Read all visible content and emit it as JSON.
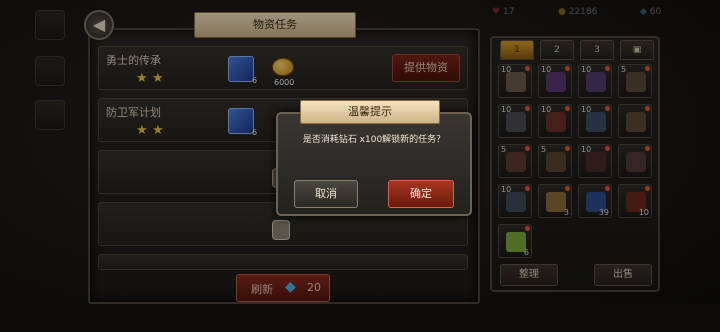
{
  "panel": {
    "title": "物资任务"
  },
  "quests": [
    {
      "name": "勇士的传承",
      "stars": 2,
      "book_qty": "6",
      "gold_qty": "6000"
    },
    {
      "name": "防卫军计划",
      "stars": 2,
      "book_qty": "6"
    }
  ],
  "supply_button": "提供物资",
  "refresh": {
    "label": "刷新",
    "cost": "20"
  },
  "resources": {
    "hp": "17",
    "gold": "22186",
    "diamond": "60"
  },
  "inventory": {
    "tabs": [
      "1",
      "2",
      "3"
    ],
    "slots": [
      {
        "qty": "10",
        "color": "#6b5a4c"
      },
      {
        "qty": "10",
        "color": "#5a3a72"
      },
      {
        "qty": "10",
        "color": "#4f3b6e"
      },
      {
        "qty": "5",
        "color": "#5a4a3a"
      },
      {
        "qty": "10",
        "color": "#4b4b55"
      },
      {
        "qty": "10",
        "color": "#6a3025"
      },
      {
        "qty": "10",
        "color": "#3b4d66"
      },
      {
        "qty": "",
        "color": "#5c4a35"
      },
      {
        "qty": "5",
        "color": "#5a3a30"
      },
      {
        "qty": "5",
        "color": "#5a4430"
      },
      {
        "qty": "10",
        "color": "#4a2a2a"
      },
      {
        "qty": "",
        "color": "#4f3b3a"
      },
      {
        "qty": "10",
        "color": "#3e4a5a"
      },
      {
        "qty": "",
        "qty_br": "3",
        "color": "#8a6a3a"
      },
      {
        "qty": "",
        "qty_br": "39",
        "color": "#2d4d8a"
      },
      {
        "qty": "",
        "qty_br": "10",
        "color": "#6a2a1a"
      },
      {
        "qty": "",
        "qty_br": "6",
        "color": "#7aa83a"
      }
    ],
    "sort_button": "整理",
    "sell_button": "出售"
  },
  "dialog": {
    "title": "温馨提示",
    "message": "是否消耗钻石 x100解锁新的任务？",
    "cancel": "取消",
    "confirm": "确定"
  },
  "colors": {
    "accent_red": "#8a2a1c",
    "gold": "#f2c13e",
    "banner": "#e8d5ae"
  }
}
